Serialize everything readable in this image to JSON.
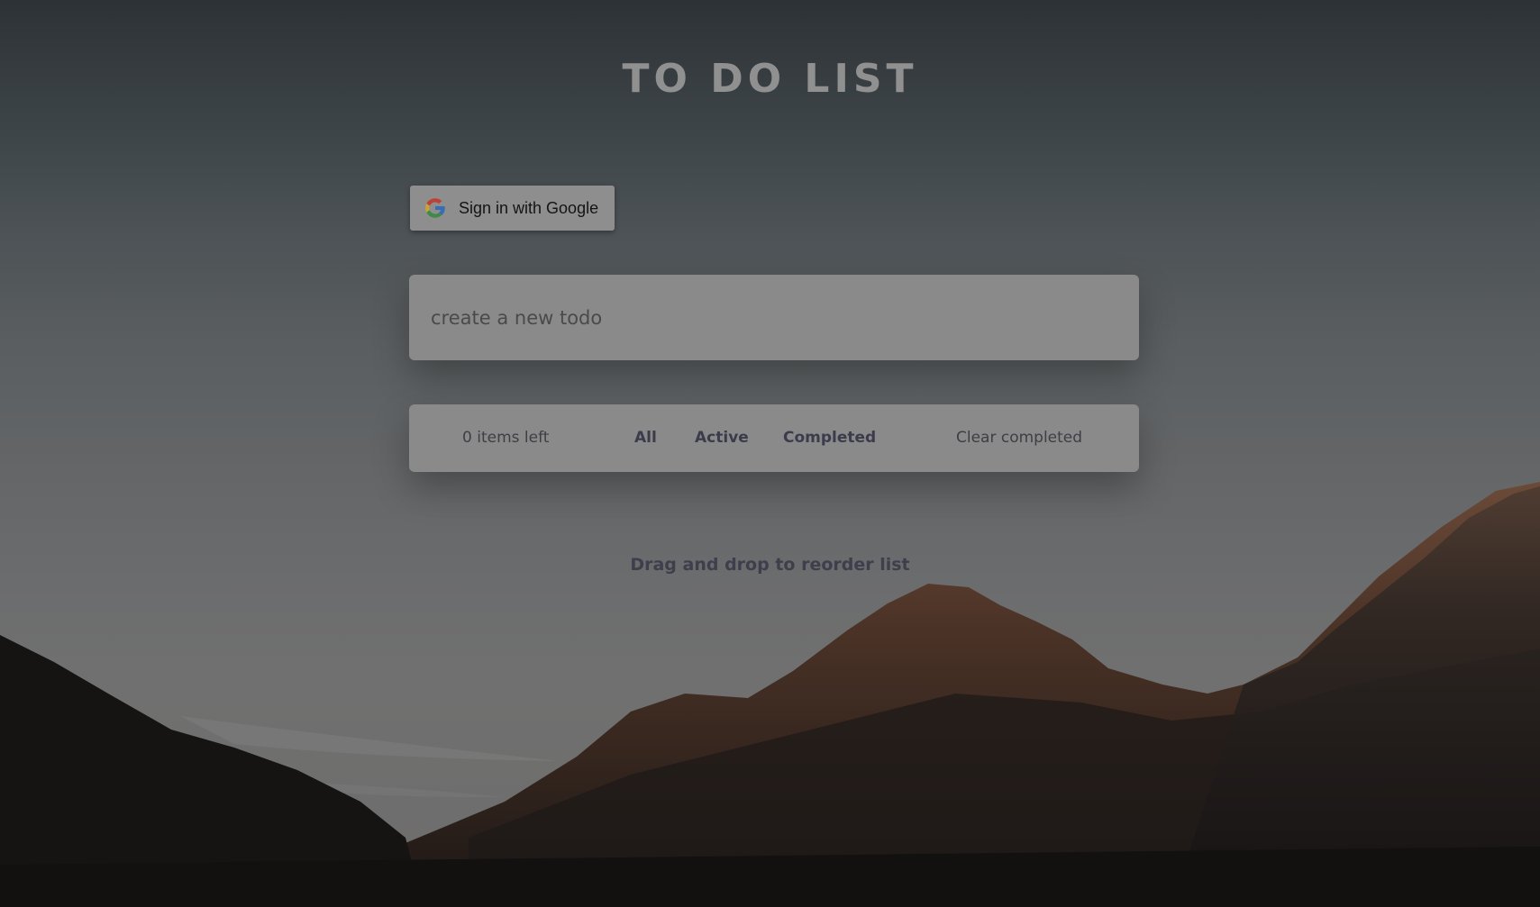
{
  "app": {
    "title": "TO DO LIST"
  },
  "auth": {
    "google_button_label": "Sign in with Google",
    "google_icon": "google-g-icon"
  },
  "new_todo": {
    "placeholder": "create a new todo",
    "value": ""
  },
  "footer": {
    "items_left": "0 items left",
    "filters": [
      {
        "label": "All"
      },
      {
        "label": "Active"
      },
      {
        "label": "Completed"
      }
    ],
    "clear_completed": "Clear completed"
  },
  "hint": "Drag and drop to reorder list",
  "colors": {
    "title": "#909090",
    "panel": "#8a8a8a",
    "filter_text": "#3b3b4c",
    "sky_top": "#2d3236",
    "mountain_dark": "#141414",
    "mountain_rock": "#4a3428"
  }
}
